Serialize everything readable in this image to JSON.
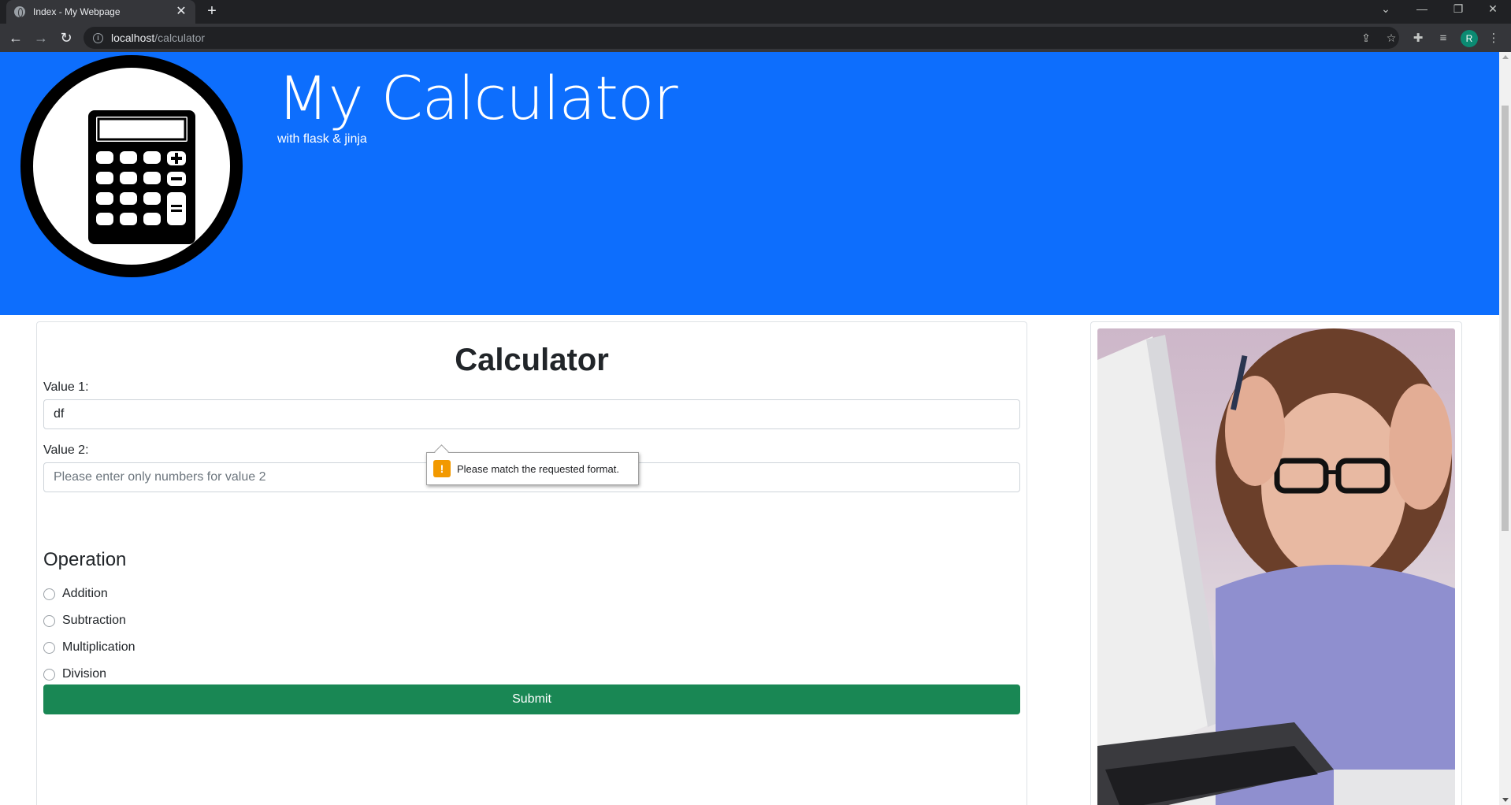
{
  "browser": {
    "tab_title": "Index - My Webpage",
    "tab_close": "✕",
    "new_tab": "+",
    "url_host": "localhost",
    "url_path": "/calculator",
    "profile_initial": "R"
  },
  "header": {
    "title": "My Calculator",
    "subtitle": "with flask & jinja",
    "banner_color": "#0d6efd"
  },
  "calculator": {
    "heading": "Calculator",
    "value1_label": "Value 1:",
    "value1_value": "df",
    "value2_label": "Value 2:",
    "value2_placeholder": "Please enter only numbers for value 2",
    "operation_title": "Operation",
    "operations": [
      "Addition",
      "Subtraction",
      "Multiplication",
      "Division"
    ],
    "submit_label": "Submit",
    "submit_color": "#198754"
  },
  "validation": {
    "message": "Please match the requested format.",
    "icon": "!"
  }
}
